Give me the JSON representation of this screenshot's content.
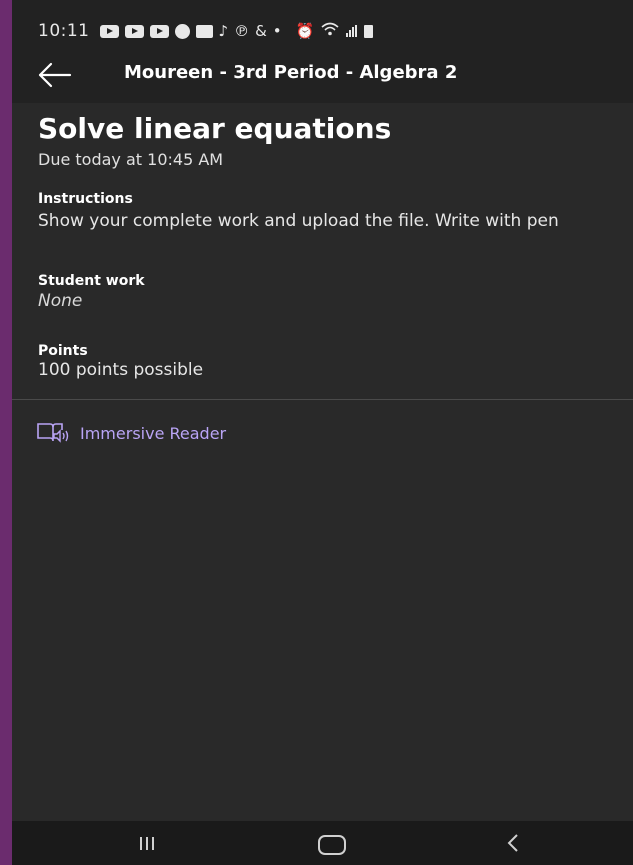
{
  "status_bar": {
    "time": "10:11",
    "notification_icons": [
      "youtube-icon",
      "youtube-icon",
      "youtube-icon",
      "facebook-icon",
      "cnn-icon",
      "tiktok-icon",
      "pinterest-icon",
      "ampersand-icon",
      "dot-icon"
    ],
    "system_icons": [
      "alarm-icon",
      "wifi-icon",
      "signal-icon",
      "battery-icon"
    ]
  },
  "app_bar": {
    "title": "Moureen - 3rd Period - Algebra 2"
  },
  "assignment": {
    "title": "Solve linear equations",
    "due": "Due today at 10:45 AM",
    "instructions_label": "Instructions",
    "instructions_text": "Show your complete work and upload the file. Write with pen",
    "student_work_label": "Student work",
    "student_work_value": "None",
    "points_label": "Points",
    "points_value": "100 points possible"
  },
  "immersive_reader": {
    "label": "Immersive Reader",
    "color": "#b9a4f5"
  },
  "colors": {
    "backdrop": "#6b2c6e",
    "background": "#292929",
    "header": "#222222"
  }
}
